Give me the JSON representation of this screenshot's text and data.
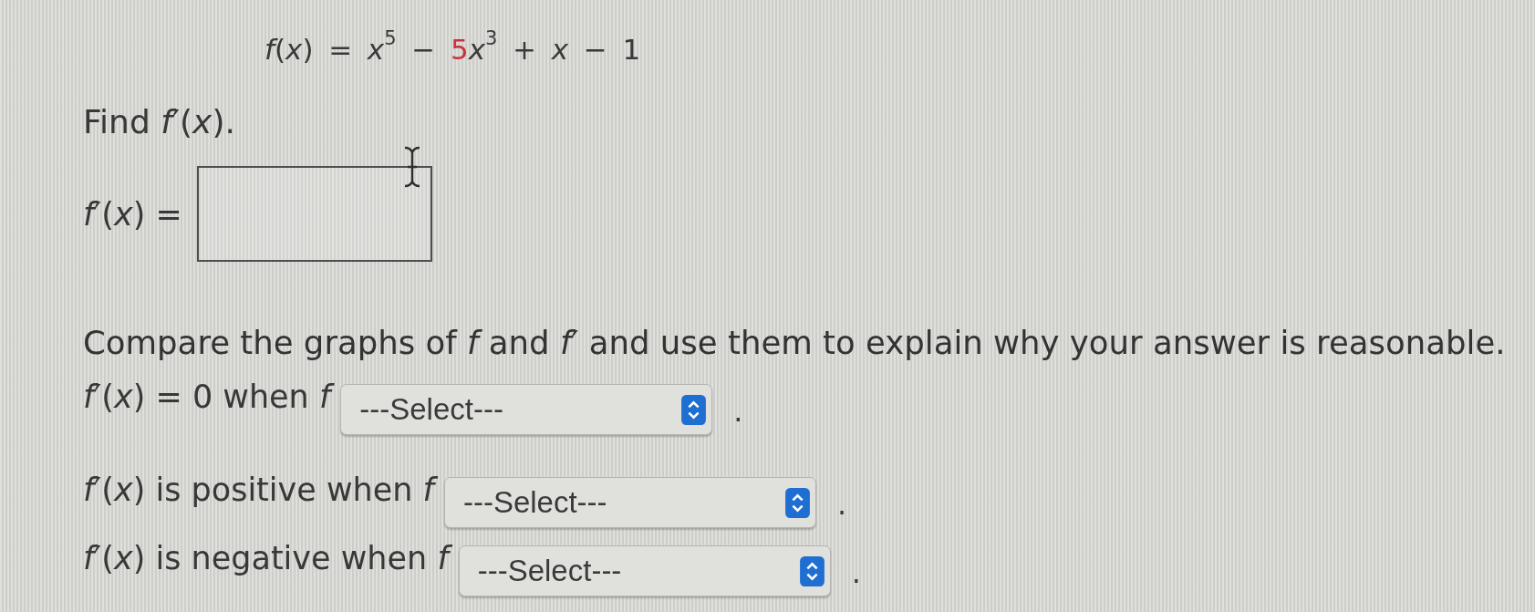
{
  "formula": {
    "parts": [
      {
        "text": "*f*(*x*) = *x*$^{5}$ − ",
        "color": "#3a3a3a"
      },
      {
        "text": "5",
        "color": "#c8323c"
      },
      {
        "text": "*x*$^{3}$ + *x* − 1",
        "color": "#3a3a3a"
      }
    ]
  },
  "question": {
    "text": "Find *f*′(*x*)."
  },
  "answer": {
    "label": "*f*′(*x*) ="
  },
  "instruction": {
    "text": "Compare the graphs of *f* and *f*′ and use them to explain why your answer is reasonable."
  },
  "statements": [
    {
      "label": "*f*′(*x*) = 0 when *f*",
      "select": "---Select---",
      "suffix": "."
    },
    {
      "label": "*f*′(*x*) is positive when *f*",
      "select": "---Select---",
      "suffix": "."
    },
    {
      "label": "*f*′(*x*) is negative when *f*",
      "select": "---Select---",
      "suffix": "."
    }
  ]
}
